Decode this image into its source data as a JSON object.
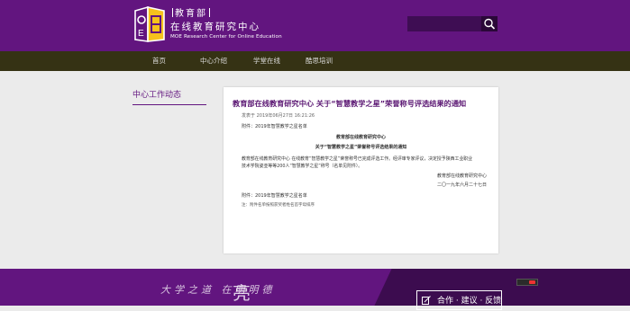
{
  "header": {
    "logo_line1_a": "教育部",
    "logo_line2": "在线教育研究中心",
    "logo_line3": "MOE Research Center for Online Education",
    "search": {
      "placeholder": "",
      "value": ""
    }
  },
  "nav": {
    "items": [
      {
        "label": "首页"
      },
      {
        "label": "中心介绍"
      },
      {
        "label": "学堂在线"
      },
      {
        "label": "酷思培训"
      }
    ]
  },
  "sidebar": {
    "title": "中心工作动态"
  },
  "article": {
    "title": "教育部在线教育研究中心 关于“智慧教学之星”荣誉称号评选结果的通知",
    "meta": "发表于 2019年06月27日 16:21:26",
    "attachment_top": "附件：2019年智慧教学之星名单",
    "heading1": "教育部在线教育研究中心",
    "heading2": "关于“智慧教学之星”荣誉称号评选结果的通知",
    "body_line1": "教育部在线教育研究中心 在线教育“智慧教学之星”荣誉称号已完成评选工作。经评审专家评议，决定授予陕西工业职业",
    "body_line2": "技术学院姿亚等等200人“智慧教学之星”称号（名单见附件）。",
    "sign_org": "教育部在线教育研究中心",
    "sign_date": "二〇一九年六月二十七日",
    "attachment_bottom": "附件：2019年智慧教学之星名单",
    "note": "注：附件名单按照获奖者姓名首字母排序"
  },
  "footer": {
    "calligraphy": "大学之道 在明明德",
    "calligraphy_big": "亮",
    "feedback_label": "合作 · 建议 · 反馈"
  },
  "colors": {
    "purple": "#62157f",
    "nav_bg": "#353214",
    "footer_dark": "#3c0c4f"
  }
}
